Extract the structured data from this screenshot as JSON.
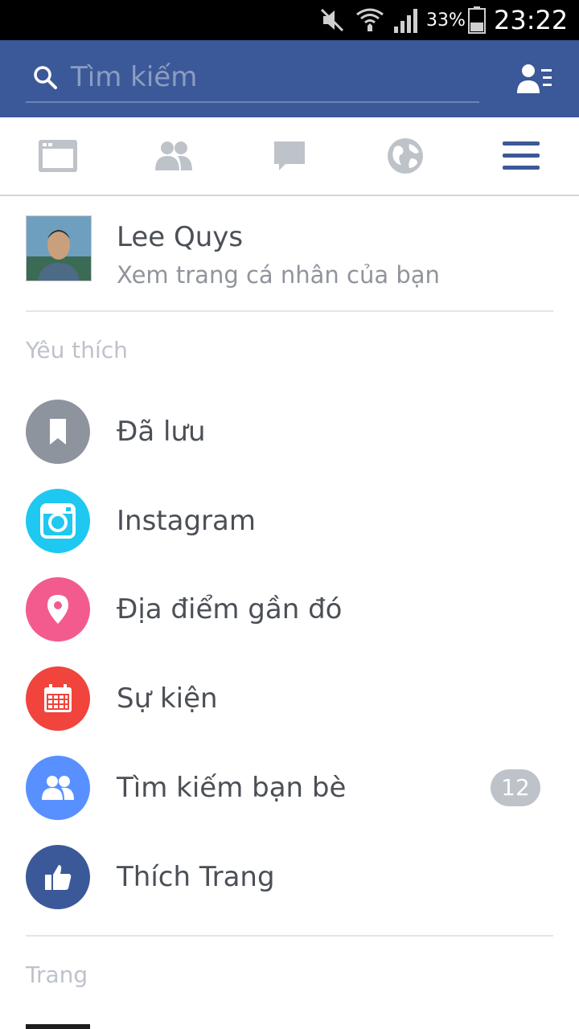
{
  "status_bar": {
    "battery_percent": "33%",
    "time": "23:22"
  },
  "header": {
    "search_placeholder": "Tìm kiếm",
    "brand_color": "#3b5998"
  },
  "tabs": [
    {
      "name": "news-feed",
      "icon": "news-feed-icon"
    },
    {
      "name": "friend-requests",
      "icon": "friends-icon"
    },
    {
      "name": "messages",
      "icon": "chat-icon"
    },
    {
      "name": "notifications",
      "icon": "globe-icon"
    },
    {
      "name": "more",
      "icon": "hamburger-menu-icon",
      "active": true
    }
  ],
  "profile": {
    "name": "Lee Quys",
    "subtitle": "Xem trang cá nhân của bạn"
  },
  "favorites": {
    "header": "Yêu thích",
    "items": [
      {
        "label": "Đã lưu",
        "icon": "bookmark-icon",
        "color": "#8d949e"
      },
      {
        "label": "Instagram",
        "icon": "camera-icon",
        "color": "#1ec8f0"
      },
      {
        "label": "Địa điểm gần đó",
        "icon": "map-pin-icon",
        "color": "#f35b8f"
      },
      {
        "label": "Sự kiện",
        "icon": "calendar-icon",
        "color": "#f0443c"
      },
      {
        "label": "Tìm kiếm bạn bè",
        "icon": "friends-icon",
        "color": "#5890ff",
        "badge": "12"
      },
      {
        "label": "Thích Trang",
        "icon": "thumbs-up-icon",
        "color": "#3b5998"
      }
    ]
  },
  "pages": {
    "header": "Trang"
  }
}
